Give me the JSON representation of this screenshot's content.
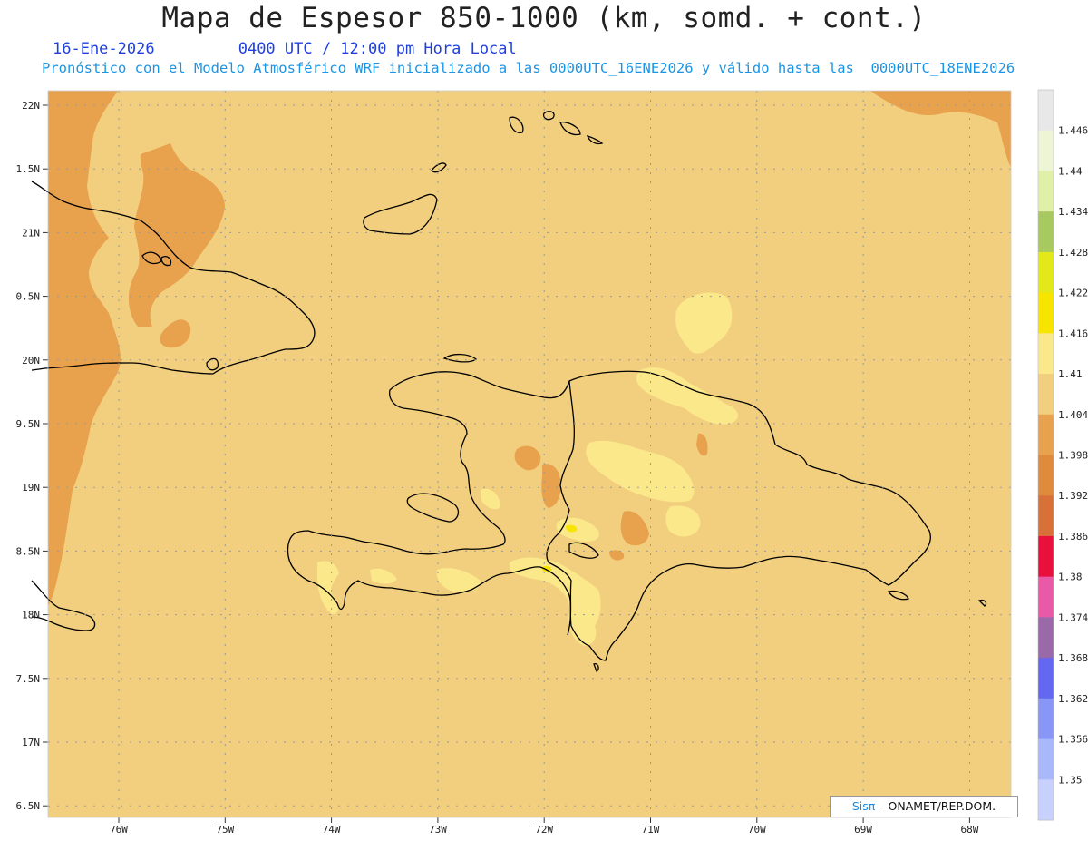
{
  "title": "Mapa de Espesor 850-1000 (km, somd. + cont.)",
  "date": "16-Ene-2026",
  "time": "0400 UTC / 12:00 pm Hora Local",
  "forecast": "Pronóstico con el Modelo Atmosférico WRF inicializado a las 0000UTC_16ENE2026 y válido hasta las  0000UTC_18ENE2026",
  "credit": {
    "logo": "Sisπ",
    "text": "– ONAMET/REP.DOM."
  },
  "lat_ticks": [
    "22N",
    "1.5N",
    "21N",
    "0.5N",
    "20N",
    "9.5N",
    "19N",
    "8.5N",
    "18N",
    "7.5N",
    "17N",
    "6.5N"
  ],
  "lon_ticks": [
    "76W",
    "75W",
    "74W",
    "73W",
    "72W",
    "71W",
    "70W",
    "69W",
    "68W"
  ],
  "colorbar": {
    "labels": [
      "1.446",
      "1.44",
      "1.434",
      "1.428",
      "1.422",
      "1.416",
      "1.41",
      "1.404",
      "1.398",
      "1.392",
      "1.386",
      "1.38",
      "1.374",
      "1.368",
      "1.362",
      "1.356",
      "1.35"
    ],
    "colors": [
      "#e8e8e8",
      "#eef4d6",
      "#e0f0a8",
      "#a8c860",
      "#e3e81a",
      "#f7e500",
      "#fbe88a",
      "#f2cf7e",
      "#e8a24e",
      "#e08a3c",
      "#d8703a",
      "#e8103c",
      "#e85aa8",
      "#9a6aa8",
      "#6468f0",
      "#8896f8",
      "#a8b8fb",
      "#c8d0fc"
    ]
  },
  "colors": {
    "sea": "#f2cf7e",
    "dark": "#e8a24e",
    "darker": "#e08a3c",
    "light": "#fbe88a",
    "yellow": "#f7e500"
  }
}
